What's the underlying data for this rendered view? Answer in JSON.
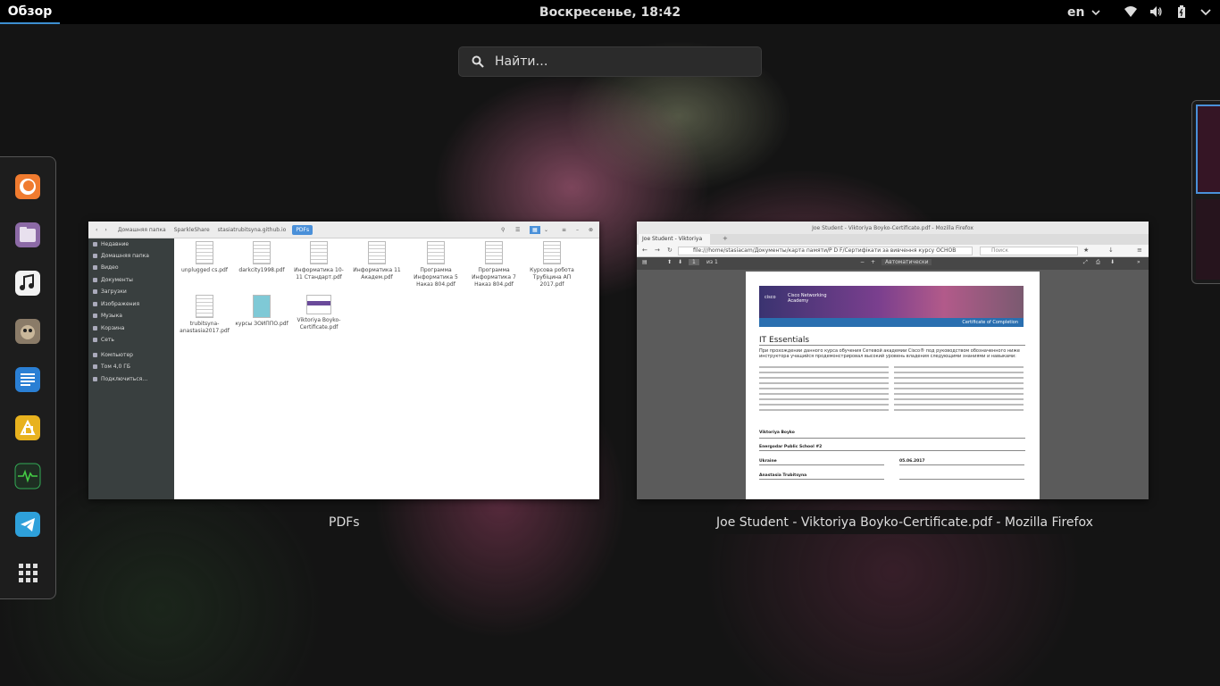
{
  "topbar": {
    "activities": "Обзор",
    "clock": "Воскресенье, 18:42",
    "language": "en"
  },
  "search": {
    "placeholder": "Найти…"
  },
  "dash": {
    "apps": [
      "firefox-icon",
      "files-icon",
      "music-icon",
      "gimp-icon",
      "text-editor-icon",
      "sketch-icon",
      "system-monitor-icon",
      "telegram-icon",
      "show-apps-icon"
    ]
  },
  "windows": {
    "files": {
      "caption": "PDFs",
      "breadcrumbs": [
        "Домашняя папка",
        "SparkleShare",
        "stasiatrubitsyna.github.io",
        "PDFs"
      ],
      "sidebar": [
        "Недавние",
        "Домашняя папка",
        "Видео",
        "Документы",
        "Загрузки",
        "Изображения",
        "Музыка",
        "Корзина",
        "Сеть",
        "Компьютер",
        "Том 4,0 ГБ",
        "Подключиться…"
      ],
      "files": [
        "unplugged cs.pdf",
        "darkcity1998.pdf",
        "Информатика 10-11 Стандарт.pdf",
        "Информатика 11 Академ.pdf",
        "Программа Информатика 5 Наказ 804.pdf",
        "Программа Информатика 7 Наказ 804.pdf",
        "Курсова робота Трубіцина АП 2017.pdf",
        "trubitsyna-anastasia2017.pdf",
        "курсы ЗОИППО.pdf",
        "Viktoriya Boyko-Certificate.pdf"
      ]
    },
    "firefox": {
      "caption": "Joe Student - Viktoriya Boyko-Certificate.pdf - Mozilla Firefox",
      "title": "Joe Student - Viktoriya Boyko-Certificate.pdf - Mozilla Firefox",
      "tab": "Joe Student - Viktoriya",
      "url": "file:///home/stasiacam/Документы/карта памяти/P D F/Сертифікати за вивчення курсу ОСНОВ",
      "search_placeholder": "Поиск",
      "page_label": "из 1",
      "zoom": "Автоматически",
      "certificate": {
        "org": "Cisco Networking Academy",
        "badge": "Certificate of Completion",
        "heading": "IT Essentials",
        "intro": "При прохождении данного курса обучения Сетевой академии Cisco® под руководством обозначенного ниже инструктора учащийся продемонстрировал высокий уровень владения следующими знаниями и навыками:",
        "student": "Viktoriya Boyko",
        "school": "Energodar Public School #2",
        "country": "Ukraine",
        "date": "05.06.2017",
        "instructor": "Anastasia Trubitsyna"
      }
    }
  }
}
